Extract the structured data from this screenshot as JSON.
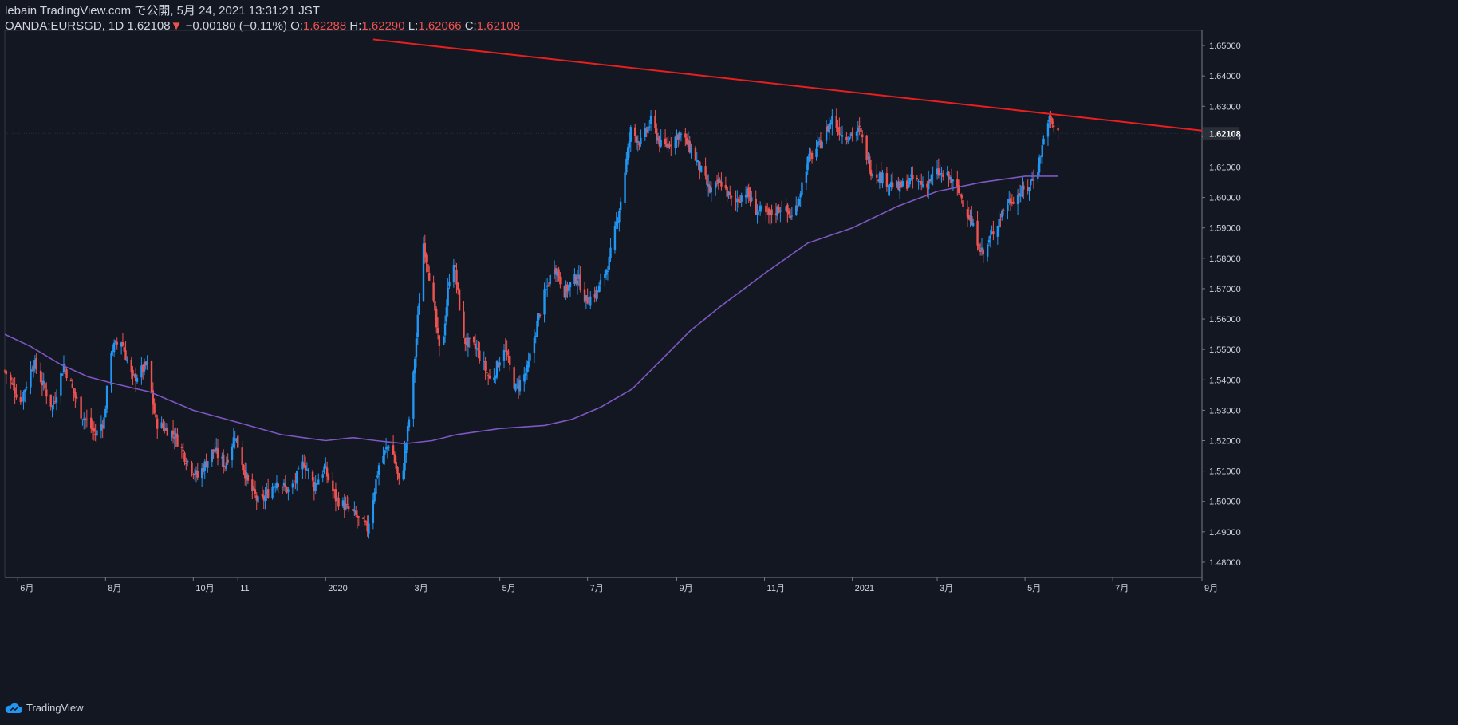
{
  "header": {
    "line1": "lebain TradingView.com で公開, 5月 24, 2021 13:31:21 JST",
    "symbol": "OANDA:EURSGD, 1D",
    "last": "1.62108",
    "arrow": "▼",
    "change": "−0.00180 (−0.11%)",
    "o_label": "O:",
    "o_value": "1.62288",
    "h_label": "H:",
    "h_value": "1.62290",
    "l_label": "L:",
    "l_value": "1.62066",
    "c_label": "C:",
    "c_value": "1.62108"
  },
  "footer": {
    "brand": "TradingView"
  },
  "colors": {
    "background": "#131722",
    "up": "#2196f3",
    "down": "#ef5350",
    "ma": "#7e57c2",
    "trendline": "#e91e1e",
    "axis_text": "#d1d4dc"
  },
  "chart_data": {
    "type": "candlestick",
    "y_range": [
      1.475,
      1.655
    ],
    "y_ticks": [
      "1.65000",
      "1.64000",
      "1.63000",
      "1.62000",
      "1.61000",
      "1.60000",
      "1.59000",
      "1.58000",
      "1.57000",
      "1.56000",
      "1.55000",
      "1.54000",
      "1.53000",
      "1.52000",
      "1.51000",
      "1.50000",
      "1.49000",
      "1.48000"
    ],
    "x_tick_labels": [
      "6月",
      "8月",
      "10月",
      "11",
      "2020",
      "3月",
      "5月",
      "7月",
      "9月",
      "11月",
      "2021",
      "3月",
      "5月",
      "7月",
      "9月"
    ],
    "x_tick_dates": [
      "2019-06-01",
      "2019-08-01",
      "2019-10-01",
      "2019-11-01",
      "2020-01-01",
      "2020-03-01",
      "2020-05-01",
      "2020-07-01",
      "2020-09-01",
      "2020-11-01",
      "2021-01-01",
      "2021-03-01",
      "2021-05-01",
      "2021-07-01",
      "2021-09-01"
    ],
    "x_range": [
      "2019-05-23",
      "2021-09-01"
    ],
    "last_price_label": "1.62108",
    "last_price": 1.62108,
    "close_path": [
      [
        "2019-05-23",
        1.543
      ],
      [
        "2019-06-03",
        1.533
      ],
      [
        "2019-06-12",
        1.546
      ],
      [
        "2019-06-25",
        1.531
      ],
      [
        "2019-07-03",
        1.545
      ],
      [
        "2019-07-15",
        1.529
      ],
      [
        "2019-07-25",
        1.522
      ],
      [
        "2019-07-31",
        1.527
      ],
      [
        "2019-08-05",
        1.55
      ],
      [
        "2019-08-12",
        1.553
      ],
      [
        "2019-08-20",
        1.54
      ],
      [
        "2019-08-30",
        1.545
      ],
      [
        "2019-09-05",
        1.526
      ],
      [
        "2019-09-18",
        1.522
      ],
      [
        "2019-09-26",
        1.514
      ],
      [
        "2019-10-04",
        1.508
      ],
      [
        "2019-10-15",
        1.517
      ],
      [
        "2019-10-23",
        1.512
      ],
      [
        "2019-10-30",
        1.522
      ],
      [
        "2019-11-08",
        1.506
      ],
      [
        "2019-11-16",
        1.499
      ],
      [
        "2019-11-28",
        1.507
      ],
      [
        "2019-12-07",
        1.503
      ],
      [
        "2019-12-17",
        1.513
      ],
      [
        "2019-12-24",
        1.505
      ],
      [
        "2019-12-31",
        1.511
      ],
      [
        "2020-01-08",
        1.501
      ],
      [
        "2020-01-20",
        1.496
      ],
      [
        "2020-01-30",
        1.491
      ],
      [
        "2020-02-07",
        1.512
      ],
      [
        "2020-02-15",
        1.52
      ],
      [
        "2020-02-22",
        1.504
      ],
      [
        "2020-03-01",
        1.535
      ],
      [
        "2020-03-09",
        1.585
      ],
      [
        "2020-03-14",
        1.572
      ],
      [
        "2020-03-21",
        1.546
      ],
      [
        "2020-03-29",
        1.583
      ],
      [
        "2020-04-06",
        1.553
      ],
      [
        "2020-04-15",
        1.55
      ],
      [
        "2020-04-25",
        1.539
      ],
      [
        "2020-05-04",
        1.551
      ],
      [
        "2020-05-12",
        1.537
      ],
      [
        "2020-05-20",
        1.543
      ],
      [
        "2020-05-30",
        1.565
      ],
      [
        "2020-06-08",
        1.578
      ],
      [
        "2020-06-15",
        1.569
      ],
      [
        "2020-06-24",
        1.574
      ],
      [
        "2020-06-30",
        1.566
      ],
      [
        "2020-07-08",
        1.569
      ],
      [
        "2020-07-16",
        1.579
      ],
      [
        "2020-07-24",
        1.599
      ],
      [
        "2020-07-31",
        1.622
      ],
      [
        "2020-08-07",
        1.618
      ],
      [
        "2020-08-14",
        1.625
      ],
      [
        "2020-08-22",
        1.616
      ],
      [
        "2020-09-03",
        1.621
      ],
      [
        "2020-09-12",
        1.615
      ],
      [
        "2020-09-24",
        1.602
      ],
      [
        "2020-10-02",
        1.605
      ],
      [
        "2020-10-10",
        1.598
      ],
      [
        "2020-10-19",
        1.602
      ],
      [
        "2020-10-26",
        1.596
      ],
      [
        "2020-11-04",
        1.594
      ],
      [
        "2020-11-13",
        1.597
      ],
      [
        "2020-11-21",
        1.593
      ],
      [
        "2020-12-01",
        1.612
      ],
      [
        "2020-12-10",
        1.618
      ],
      [
        "2020-12-18",
        1.626
      ],
      [
        "2020-12-26",
        1.62
      ],
      [
        "2021-01-06",
        1.622
      ],
      [
        "2021-01-14",
        1.609
      ],
      [
        "2021-01-23",
        1.606
      ],
      [
        "2021-02-02",
        1.603
      ],
      [
        "2021-02-12",
        1.606
      ],
      [
        "2021-02-20",
        1.604
      ],
      [
        "2021-03-01",
        1.608
      ],
      [
        "2021-03-10",
        1.606
      ],
      [
        "2021-03-18",
        1.6
      ],
      [
        "2021-03-26",
        1.59
      ],
      [
        "2021-04-02",
        1.581
      ],
      [
        "2021-04-10",
        1.59
      ],
      [
        "2021-04-18",
        1.598
      ],
      [
        "2021-04-26",
        1.601
      ],
      [
        "2021-05-03",
        1.603
      ],
      [
        "2021-05-10",
        1.61
      ],
      [
        "2021-05-17",
        1.626
      ],
      [
        "2021-05-24",
        1.621
      ]
    ],
    "moving_average": [
      [
        "2019-05-23",
        1.555
      ],
      [
        "2019-06-10",
        1.551
      ],
      [
        "2019-07-01",
        1.545
      ],
      [
        "2019-07-20",
        1.541
      ],
      [
        "2019-08-05",
        1.539
      ],
      [
        "2019-09-01",
        1.536
      ],
      [
        "2019-10-01",
        1.53
      ],
      [
        "2019-11-01",
        1.526
      ],
      [
        "2019-12-01",
        1.522
      ],
      [
        "2020-01-01",
        1.52
      ],
      [
        "2020-01-20",
        1.521
      ],
      [
        "2020-02-05",
        1.52
      ],
      [
        "2020-02-25",
        1.519
      ],
      [
        "2020-03-15",
        1.52
      ],
      [
        "2020-04-01",
        1.522
      ],
      [
        "2020-05-01",
        1.524
      ],
      [
        "2020-06-01",
        1.525
      ],
      [
        "2020-06-20",
        1.527
      ],
      [
        "2020-07-10",
        1.531
      ],
      [
        "2020-08-01",
        1.537
      ],
      [
        "2020-08-20",
        1.546
      ],
      [
        "2020-09-10",
        1.556
      ],
      [
        "2020-10-01",
        1.564
      ],
      [
        "2020-11-01",
        1.575
      ],
      [
        "2020-12-01",
        1.585
      ],
      [
        "2021-01-01",
        1.59
      ],
      [
        "2021-02-01",
        1.597
      ],
      [
        "2021-03-01",
        1.602
      ],
      [
        "2021-04-01",
        1.605
      ],
      [
        "2021-05-01",
        1.607
      ],
      [
        "2021-05-24",
        1.607
      ]
    ],
    "trendline": [
      [
        "2020-02-03",
        1.652
      ],
      [
        "2021-09-01",
        1.622
      ]
    ]
  }
}
